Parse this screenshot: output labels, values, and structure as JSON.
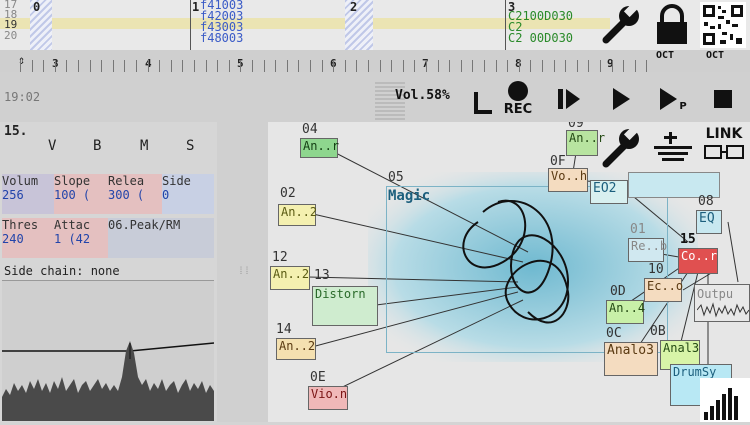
{
  "pattern": {
    "row_numbers": [
      "17",
      "18",
      "19",
      "20"
    ],
    "tracks": [
      {
        "num": "0"
      },
      {
        "num": "1",
        "lines": [
          "f41003",
          "f42003",
          "f43003",
          "f48003"
        ]
      },
      {
        "num": "2"
      },
      {
        "num": "3",
        "lines": [
          "C2100D030",
          "C2100D030",
          "C2",
          "C2 00D030"
        ]
      }
    ]
  },
  "ruler": {
    "marks": [
      "3",
      "4",
      "5",
      "6",
      "7",
      "8",
      "9"
    ]
  },
  "transport": {
    "time": "19:02",
    "volume": "Vol.58%",
    "rec_label": "REC",
    "play_pattern_label": "P",
    "link_label": "LINK",
    "oct_minus": "OCT",
    "oct_plus": "OCT"
  },
  "left_panel": {
    "module_id": "15.",
    "columns": [
      "V",
      "B",
      "M",
      "S"
    ],
    "slots": [
      {
        "name": "Volum",
        "value": "256",
        "bg": "#c8c4d8"
      },
      {
        "name": "Slope",
        "value": "100 (",
        "bg": "#e4c0c0"
      },
      {
        "name": "Relea",
        "value": "300 (",
        "bg": "#e4c0c0"
      },
      {
        "name": "Side",
        "value": "0",
        "bg": "#c8d0e4"
      },
      {
        "name": "Thres",
        "value": "240",
        "bg": "#e4c0c0"
      },
      {
        "name": "Attac",
        "value": "1 (42",
        "bg": "#e4c0c0"
      },
      {
        "name": "06.Peak/RM",
        "value": "",
        "bg": "#c8ccd8"
      }
    ],
    "side_chain": "Side chain: none"
  },
  "graph": {
    "nodes": [
      {
        "id": "04",
        "label": "An..r",
        "color": "#8ed68e"
      },
      {
        "id": "02",
        "label": "An..2",
        "color": "#f4f0b0"
      },
      {
        "id": "05",
        "label": "Magic",
        "color": "#9ed0e0"
      },
      {
        "id": "12",
        "label": "An..2",
        "color": "#f4f0b0"
      },
      {
        "id": "13",
        "label": "Distorn",
        "color": "#cfeccf"
      },
      {
        "id": "14",
        "label": "An..2",
        "color": "#f4e0b0"
      },
      {
        "id": "0E",
        "label": "Vio.n",
        "color": "#f0b8b8"
      },
      {
        "id": "09",
        "label": "An..r",
        "color": "#b8e4a0"
      },
      {
        "id": "0F",
        "label": "Vo..h",
        "color": "#f4dcc0"
      },
      {
        "id": "",
        "label": "EO2",
        "color": "#d8f0f0"
      },
      {
        "id": "08",
        "label": "EQ",
        "color": "#c8e8f0"
      },
      {
        "id": "01",
        "label": "Re..b",
        "color": "#d0e8f0"
      },
      {
        "id": "15",
        "label": "Co..r",
        "color": "#e05050"
      },
      {
        "id": "10",
        "label": "Ec..o",
        "color": "#f4dcc0"
      },
      {
        "id": "0D",
        "label": "An..4",
        "color": "#c8f0a8"
      },
      {
        "id": "",
        "label": "Outpu",
        "color": "#e8e8e8"
      },
      {
        "id": "0C",
        "label": "Analo3",
        "color": "#f4dcc0"
      },
      {
        "id": "0B",
        "label": "Anal3",
        "color": "#d8f4a8"
      },
      {
        "id": "",
        "label": "DrumSy",
        "color": "#b8e8f4"
      }
    ]
  }
}
